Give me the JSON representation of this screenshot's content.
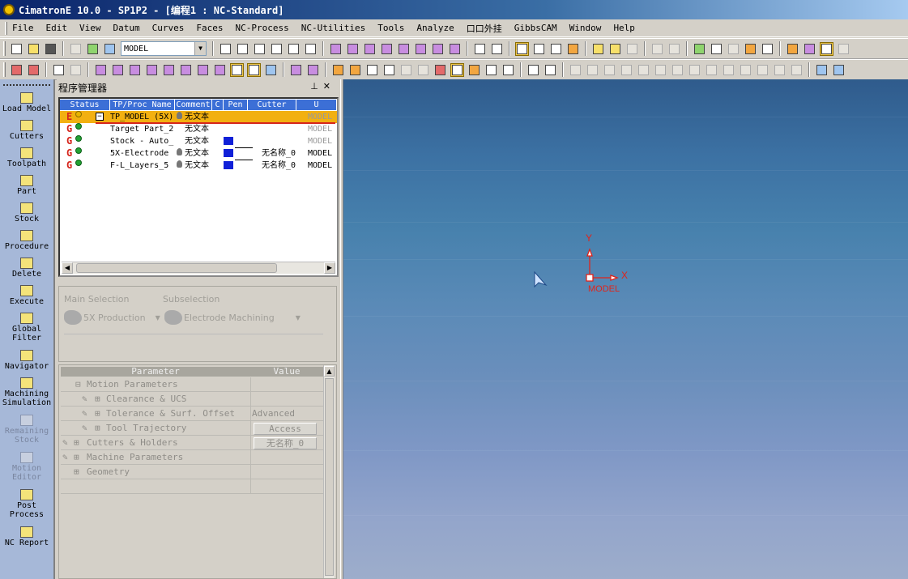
{
  "window": {
    "title": "CimatronE 10.0 - SP1P2 - [编程1 : NC-Standard]"
  },
  "menu": [
    "File",
    "Edit",
    "View",
    "Datum",
    "Curves",
    "Faces",
    "NC-Process",
    "NC-Utilities",
    "Tools",
    "Analyze",
    "口口外挂",
    "GibbsCAM",
    "Window",
    "Help"
  ],
  "toolbar": {
    "model_select": "MODEL"
  },
  "sidebar": [
    {
      "label": "Load Model",
      "icon": "load-model-icon",
      "enabled": true
    },
    {
      "label": "Cutters",
      "icon": "cutters-icon",
      "enabled": true
    },
    {
      "label": "Toolpath",
      "icon": "toolpath-icon",
      "enabled": true
    },
    {
      "label": "Part",
      "icon": "part-icon",
      "enabled": true
    },
    {
      "label": "Stock",
      "icon": "stock-icon",
      "enabled": true
    },
    {
      "label": "Procedure",
      "icon": "procedure-icon",
      "enabled": true
    },
    {
      "label": "Delete",
      "icon": "delete-icon",
      "enabled": true
    },
    {
      "label": "Execute",
      "icon": "execute-icon",
      "enabled": true
    },
    {
      "label": "Global Filter",
      "icon": "global-filter-icon",
      "enabled": true
    },
    {
      "label": "Navigator",
      "icon": "navigator-icon",
      "enabled": true
    },
    {
      "label": "Machining Simulation",
      "icon": "machining-simulation-icon",
      "enabled": true
    },
    {
      "label": "Remaining Stock",
      "icon": "remaining-stock-icon",
      "enabled": false
    },
    {
      "label": "Motion Editor",
      "icon": "motion-editor-icon",
      "enabled": false
    },
    {
      "label": "Post Process",
      "icon": "post-process-icon",
      "enabled": true
    },
    {
      "label": "NC Report",
      "icon": "nc-report-icon",
      "enabled": true
    }
  ],
  "program_manager": {
    "title": "程序管理器",
    "columns": [
      "Status",
      "TP/Proc Name",
      "Comment",
      "C",
      "Pen",
      "Cutter",
      "U"
    ],
    "rows": [
      {
        "status": "E",
        "name": "TP_MODEL (5X)",
        "comment": "无文本",
        "pen": false,
        "cutter": "",
        "uframe": "MODEL",
        "selected": true
      },
      {
        "status": "G",
        "name": "Target Part_2",
        "comment": "无文本",
        "pen": false,
        "cutter": "",
        "uframe": "MODEL",
        "selected": false
      },
      {
        "status": "G",
        "name": "Stock - Auto_",
        "comment": "无文本",
        "pen": true,
        "cutter": "",
        "uframe": "MODEL",
        "selected": false
      },
      {
        "status": "G",
        "name": "5X-Electrode",
        "comment": "无文本",
        "pen": true,
        "cutter": "无名称_0",
        "uframe": "MODEL",
        "selected": false
      },
      {
        "status": "G",
        "name": "F-L_Layers_5",
        "comment": "无文本",
        "pen": true,
        "cutter": "无名称_0",
        "uframe": "MODEL",
        "selected": false
      }
    ]
  },
  "selection": {
    "main_label": "Main Selection",
    "main_value": "5X Production",
    "sub_label": "Subselection",
    "sub_value": "Electrode Machining"
  },
  "parameters": {
    "header_param": "Parameter",
    "header_value": "Value",
    "rows": [
      {
        "label": "Motion Parameters",
        "value": ""
      },
      {
        "label": "Clearance & UCS",
        "value": ""
      },
      {
        "label": "Tolerance & Surf. Offset",
        "value": "Advanced"
      },
      {
        "label": "Tool Trajectory",
        "value": "Access"
      },
      {
        "label": "Cutters & Holders",
        "value": "无名称_0"
      },
      {
        "label": "Machine Parameters",
        "value": ""
      },
      {
        "label": "Geometry",
        "value": ""
      }
    ]
  },
  "viewport": {
    "axis_y": "Y",
    "axis_x": "X",
    "axis_label": "MODEL",
    "axis_color": "#e0241b"
  },
  "colors": {
    "title_start": "#0a246a",
    "selected_row": "#f2b011",
    "header_blue": "#3c6fd6",
    "pen_blue": "#1020d8"
  }
}
